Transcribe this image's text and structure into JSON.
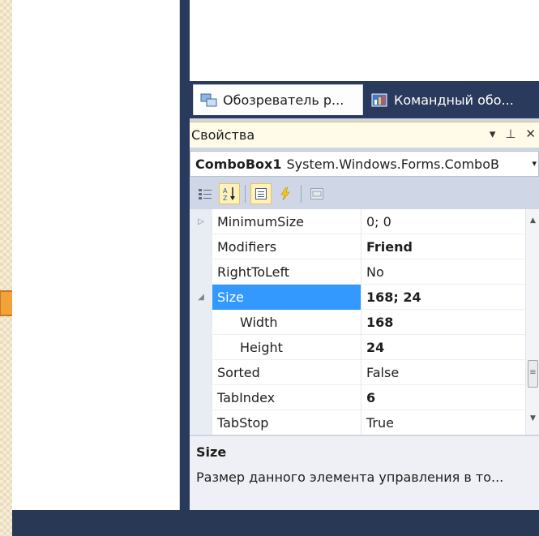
{
  "tabs": [
    {
      "label": "Обозреватель р...",
      "icon": "solution-explorer-icon"
    },
    {
      "label": "Командный обо...",
      "icon": "team-explorer-icon"
    }
  ],
  "properties_panel": {
    "title": "Свойства",
    "object_name": "ComboBox1",
    "object_type": "System.Windows.Forms.ComboB",
    "rows": [
      {
        "name": "MinimumSize",
        "value": "0; 0",
        "bold": false,
        "expander": "collapsed"
      },
      {
        "name": "Modifiers",
        "value": "Friend",
        "bold": true
      },
      {
        "name": "RightToLeft",
        "value": "No",
        "bold": false
      },
      {
        "name": "Size",
        "value": "168; 24",
        "bold": true,
        "expander": "expanded",
        "selected": true
      },
      {
        "name": "Width",
        "value": "168",
        "bold": true,
        "child": true
      },
      {
        "name": "Height",
        "value": "24",
        "bold": true,
        "child": true
      },
      {
        "name": "Sorted",
        "value": "False",
        "bold": false
      },
      {
        "name": "TabIndex",
        "value": "6",
        "bold": true
      },
      {
        "name": "TabStop",
        "value": "True",
        "bold": false
      }
    ],
    "description_title": "Size",
    "description_text": "Размер данного элемента управления в то..."
  },
  "colors": {
    "arrow": "#f2a23a",
    "selection": "#3399ff",
    "ide_dark": "#2a3a5c"
  }
}
